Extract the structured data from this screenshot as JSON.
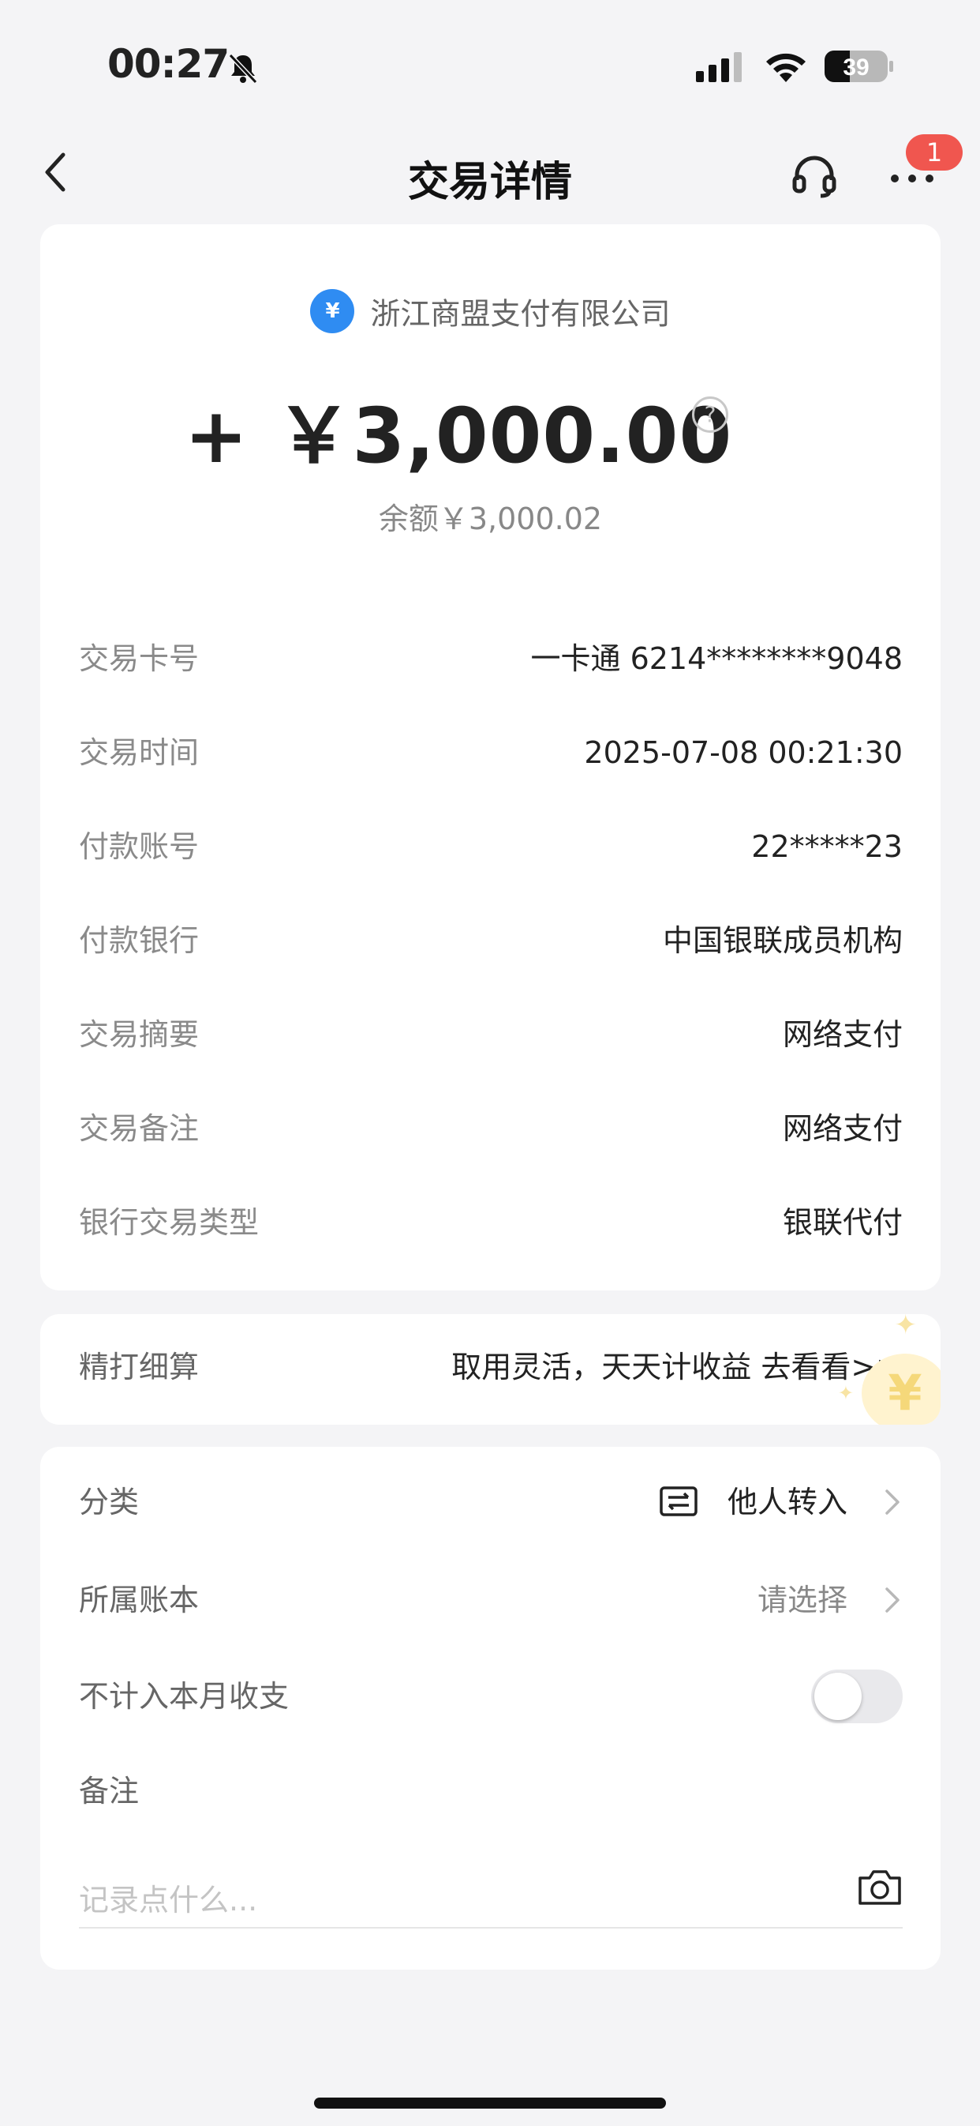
{
  "status_bar": {
    "time": "00:27",
    "battery": "39"
  },
  "nav": {
    "title": "交易详情",
    "notification_count": "1"
  },
  "transaction": {
    "merchant": "浙江商盟支付有限公司",
    "merchant_icon_glyph": "¥",
    "amount": "+ ￥3,000.00",
    "balance": "余额￥3,000.02",
    "details": [
      {
        "label": "交易卡号",
        "value": "一卡通 6214********9048"
      },
      {
        "label": "交易时间",
        "value": "2025-07-08 00:21:30"
      },
      {
        "label": "付款账号",
        "value": "22*****23"
      },
      {
        "label": "付款银行",
        "value": "中国银联成员机构"
      },
      {
        "label": "交易摘要",
        "value": "网络支付"
      },
      {
        "label": "交易备注",
        "value": "网络支付"
      },
      {
        "label": "银行交易类型",
        "value": "银联代付"
      }
    ]
  },
  "promo": {
    "label": "精打细算",
    "text": "取用灵活，天天计收益 去看看>>"
  },
  "settings": {
    "category": {
      "label": "分类",
      "value": "他人转入"
    },
    "ledger": {
      "label": "所属账本",
      "value": "请选择"
    },
    "exclude": {
      "label": "不计入本月收支",
      "enabled": false
    },
    "note": {
      "label": "备注",
      "placeholder": "记录点什么..."
    }
  },
  "colors": {
    "badge": "#f0564f",
    "merchant_icon": "#2f8cf2",
    "background": "#f4f4f6"
  },
  "icons": [
    "bell-slash-icon",
    "signal-icon",
    "wifi-icon",
    "battery-icon",
    "back-icon",
    "headset-icon",
    "more-icon",
    "help-icon",
    "transfer-icon",
    "chevron-right-icon",
    "camera-icon"
  ]
}
